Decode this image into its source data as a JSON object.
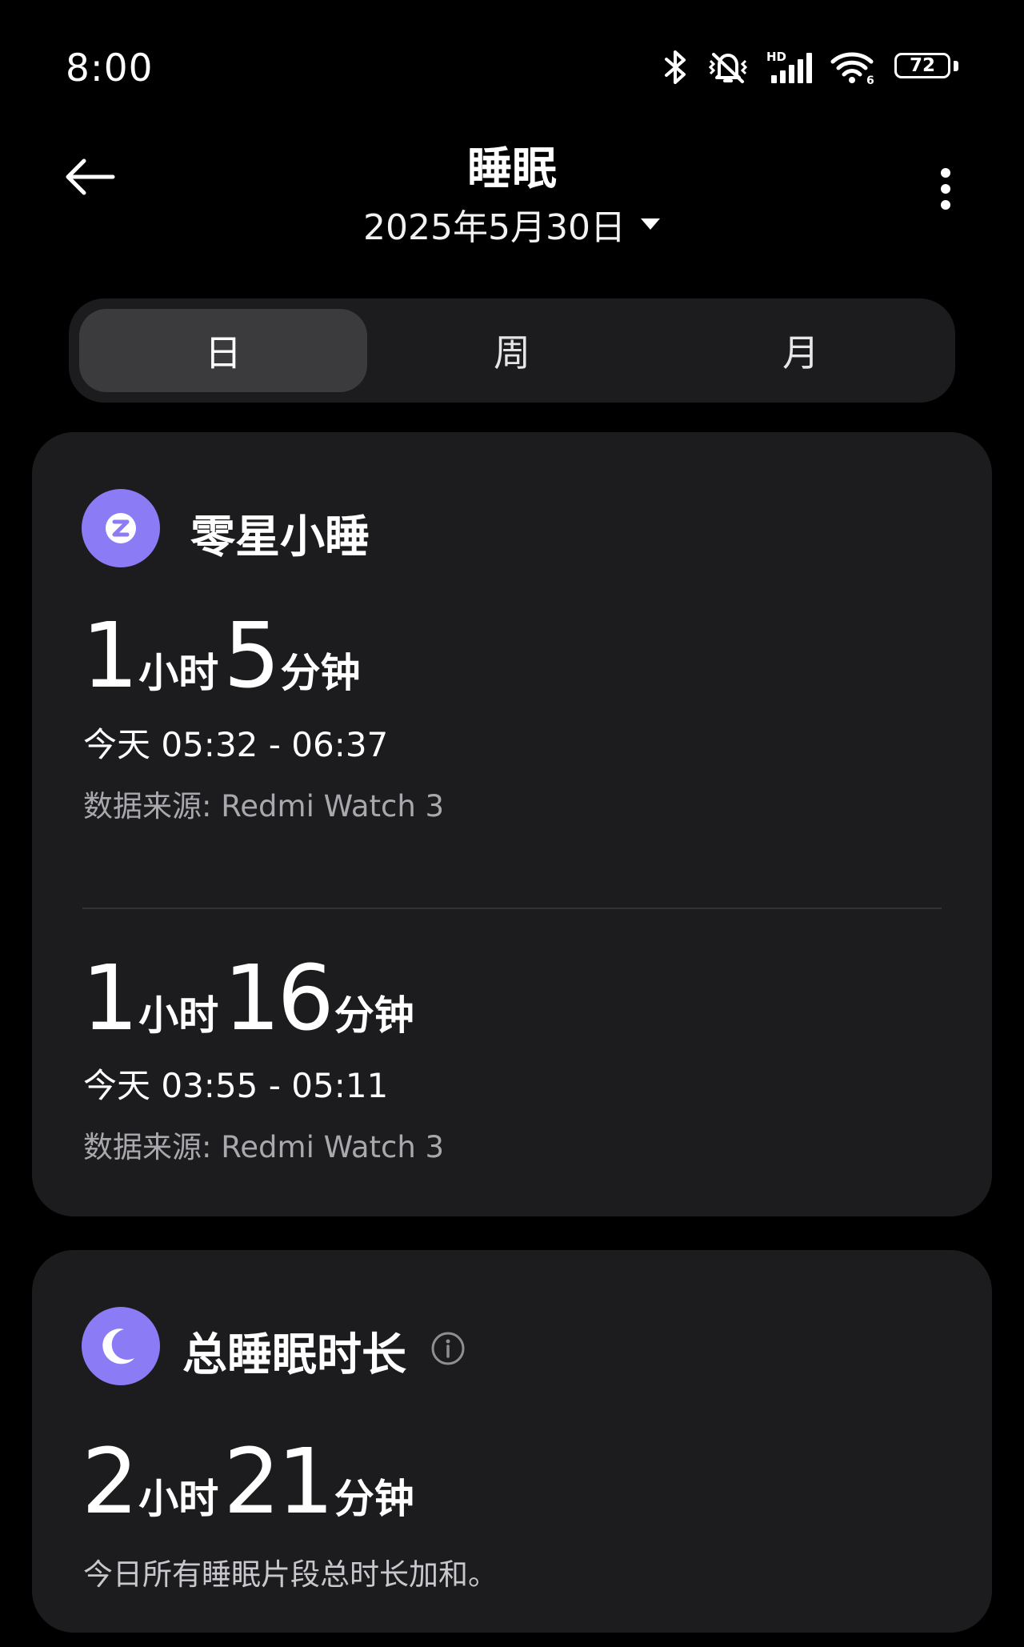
{
  "status_bar": {
    "time": "8:00",
    "battery": "72",
    "hd_label": "HD",
    "wifi_badge": "6",
    "icons": [
      "bluetooth-icon",
      "mute-vibrate-icon",
      "signal-icon",
      "wifi-icon",
      "battery-icon"
    ]
  },
  "header": {
    "title": "睡眠",
    "date": "2025年5月30日"
  },
  "tabs": [
    {
      "label": "日",
      "active": true
    },
    {
      "label": "周",
      "active": false
    },
    {
      "label": "月",
      "active": false
    }
  ],
  "nap_card": {
    "title": "零星小睡",
    "icon_color": "#8b7cf6",
    "entries": [
      {
        "hours": "1",
        "hours_unit": "小时",
        "minutes": "5",
        "minutes_unit": "分钟",
        "time_range": "今天 05:32 - 06:37",
        "source": "数据来源: Redmi Watch 3"
      },
      {
        "hours": "1",
        "hours_unit": "小时",
        "minutes": "16",
        "minutes_unit": "分钟",
        "time_range": "今天 03:55 - 05:11",
        "source": "数据来源: Redmi Watch 3"
      }
    ]
  },
  "total_card": {
    "title": "总睡眠时长",
    "icon_color": "#8b7cf6",
    "hours": "2",
    "hours_unit": "小时",
    "minutes": "21",
    "minutes_unit": "分钟",
    "summary": "今日所有睡眠片段总时长加和。"
  },
  "colors": {
    "background": "#000000",
    "card": "#1c1c1e",
    "accent": "#8b7cf6"
  }
}
